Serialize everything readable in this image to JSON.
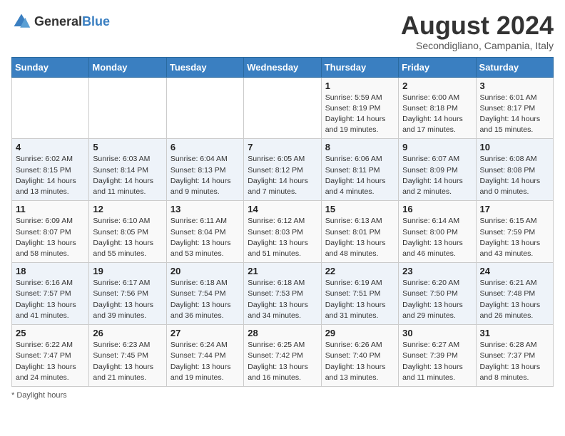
{
  "header": {
    "logo_general": "General",
    "logo_blue": "Blue",
    "month_year": "August 2024",
    "location": "Secondigliano, Campania, Italy"
  },
  "weekdays": [
    "Sunday",
    "Monday",
    "Tuesday",
    "Wednesday",
    "Thursday",
    "Friday",
    "Saturday"
  ],
  "weeks": [
    [
      {
        "day": "",
        "info": ""
      },
      {
        "day": "",
        "info": ""
      },
      {
        "day": "",
        "info": ""
      },
      {
        "day": "",
        "info": ""
      },
      {
        "day": "1",
        "info": "Sunrise: 5:59 AM\nSunset: 8:19 PM\nDaylight: 14 hours\nand 19 minutes."
      },
      {
        "day": "2",
        "info": "Sunrise: 6:00 AM\nSunset: 8:18 PM\nDaylight: 14 hours\nand 17 minutes."
      },
      {
        "day": "3",
        "info": "Sunrise: 6:01 AM\nSunset: 8:17 PM\nDaylight: 14 hours\nand 15 minutes."
      }
    ],
    [
      {
        "day": "4",
        "info": "Sunrise: 6:02 AM\nSunset: 8:15 PM\nDaylight: 14 hours\nand 13 minutes."
      },
      {
        "day": "5",
        "info": "Sunrise: 6:03 AM\nSunset: 8:14 PM\nDaylight: 14 hours\nand 11 minutes."
      },
      {
        "day": "6",
        "info": "Sunrise: 6:04 AM\nSunset: 8:13 PM\nDaylight: 14 hours\nand 9 minutes."
      },
      {
        "day": "7",
        "info": "Sunrise: 6:05 AM\nSunset: 8:12 PM\nDaylight: 14 hours\nand 7 minutes."
      },
      {
        "day": "8",
        "info": "Sunrise: 6:06 AM\nSunset: 8:11 PM\nDaylight: 14 hours\nand 4 minutes."
      },
      {
        "day": "9",
        "info": "Sunrise: 6:07 AM\nSunset: 8:09 PM\nDaylight: 14 hours\nand 2 minutes."
      },
      {
        "day": "10",
        "info": "Sunrise: 6:08 AM\nSunset: 8:08 PM\nDaylight: 14 hours\nand 0 minutes."
      }
    ],
    [
      {
        "day": "11",
        "info": "Sunrise: 6:09 AM\nSunset: 8:07 PM\nDaylight: 13 hours\nand 58 minutes."
      },
      {
        "day": "12",
        "info": "Sunrise: 6:10 AM\nSunset: 8:05 PM\nDaylight: 13 hours\nand 55 minutes."
      },
      {
        "day": "13",
        "info": "Sunrise: 6:11 AM\nSunset: 8:04 PM\nDaylight: 13 hours\nand 53 minutes."
      },
      {
        "day": "14",
        "info": "Sunrise: 6:12 AM\nSunset: 8:03 PM\nDaylight: 13 hours\nand 51 minutes."
      },
      {
        "day": "15",
        "info": "Sunrise: 6:13 AM\nSunset: 8:01 PM\nDaylight: 13 hours\nand 48 minutes."
      },
      {
        "day": "16",
        "info": "Sunrise: 6:14 AM\nSunset: 8:00 PM\nDaylight: 13 hours\nand 46 minutes."
      },
      {
        "day": "17",
        "info": "Sunrise: 6:15 AM\nSunset: 7:59 PM\nDaylight: 13 hours\nand 43 minutes."
      }
    ],
    [
      {
        "day": "18",
        "info": "Sunrise: 6:16 AM\nSunset: 7:57 PM\nDaylight: 13 hours\nand 41 minutes."
      },
      {
        "day": "19",
        "info": "Sunrise: 6:17 AM\nSunset: 7:56 PM\nDaylight: 13 hours\nand 39 minutes."
      },
      {
        "day": "20",
        "info": "Sunrise: 6:18 AM\nSunset: 7:54 PM\nDaylight: 13 hours\nand 36 minutes."
      },
      {
        "day": "21",
        "info": "Sunrise: 6:18 AM\nSunset: 7:53 PM\nDaylight: 13 hours\nand 34 minutes."
      },
      {
        "day": "22",
        "info": "Sunrise: 6:19 AM\nSunset: 7:51 PM\nDaylight: 13 hours\nand 31 minutes."
      },
      {
        "day": "23",
        "info": "Sunrise: 6:20 AM\nSunset: 7:50 PM\nDaylight: 13 hours\nand 29 minutes."
      },
      {
        "day": "24",
        "info": "Sunrise: 6:21 AM\nSunset: 7:48 PM\nDaylight: 13 hours\nand 26 minutes."
      }
    ],
    [
      {
        "day": "25",
        "info": "Sunrise: 6:22 AM\nSunset: 7:47 PM\nDaylight: 13 hours\nand 24 minutes."
      },
      {
        "day": "26",
        "info": "Sunrise: 6:23 AM\nSunset: 7:45 PM\nDaylight: 13 hours\nand 21 minutes."
      },
      {
        "day": "27",
        "info": "Sunrise: 6:24 AM\nSunset: 7:44 PM\nDaylight: 13 hours\nand 19 minutes."
      },
      {
        "day": "28",
        "info": "Sunrise: 6:25 AM\nSunset: 7:42 PM\nDaylight: 13 hours\nand 16 minutes."
      },
      {
        "day": "29",
        "info": "Sunrise: 6:26 AM\nSunset: 7:40 PM\nDaylight: 13 hours\nand 13 minutes."
      },
      {
        "day": "30",
        "info": "Sunrise: 6:27 AM\nSunset: 7:39 PM\nDaylight: 13 hours\nand 11 minutes."
      },
      {
        "day": "31",
        "info": "Sunrise: 6:28 AM\nSunset: 7:37 PM\nDaylight: 13 hours\nand 8 minutes."
      }
    ]
  ],
  "footer": {
    "note": "Daylight hours"
  }
}
